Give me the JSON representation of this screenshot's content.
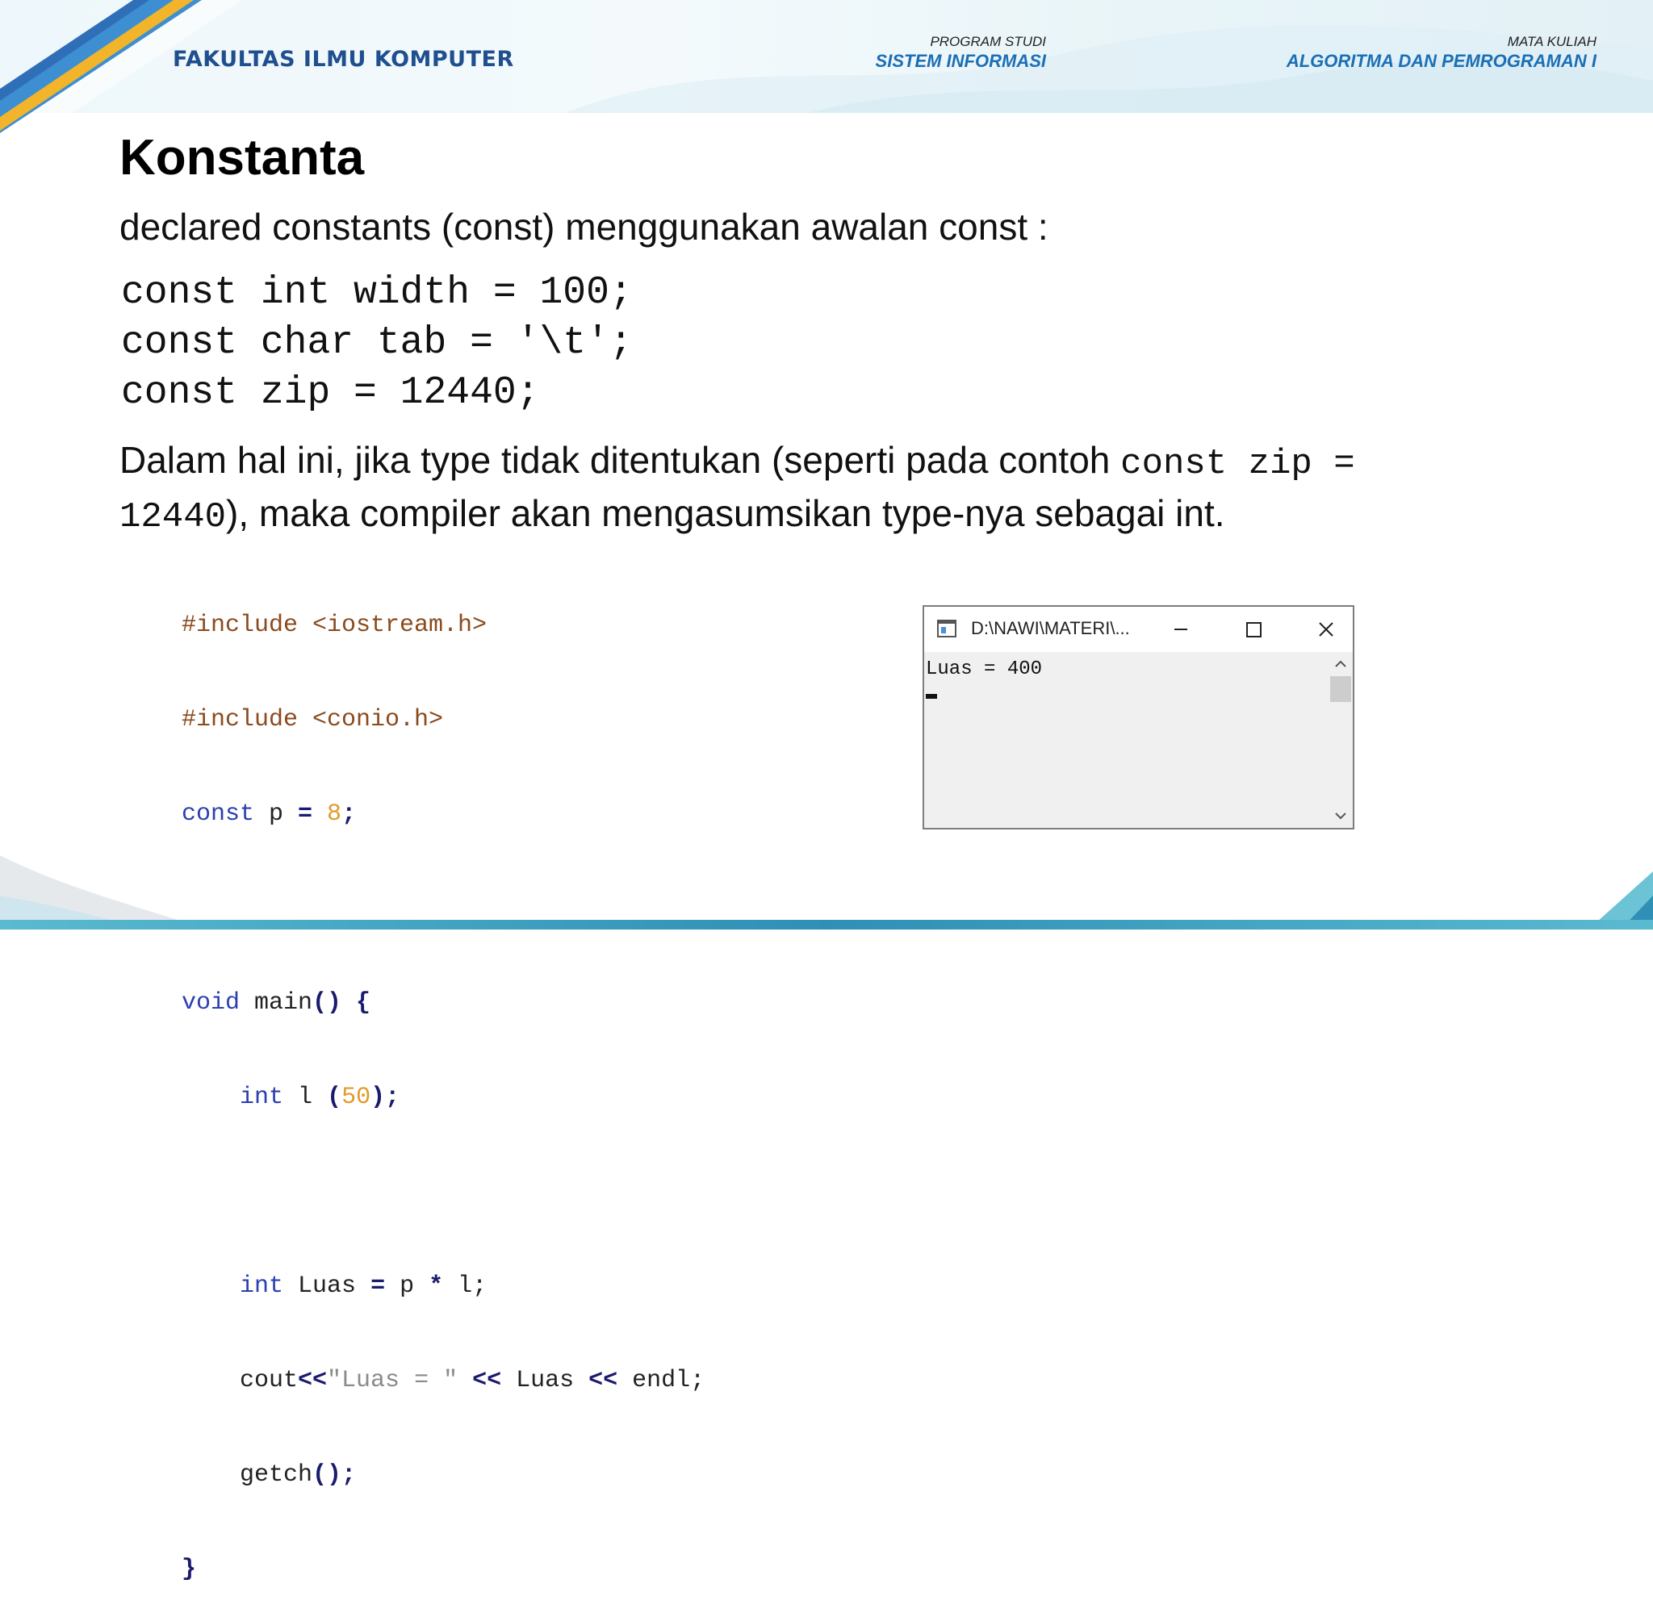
{
  "header": {
    "faculty": "FAKULTAS ILMU KOMPUTER",
    "program_caption": "PROGRAM STUDI",
    "program_value": "SISTEM INFORMASI",
    "course_caption": "MATA KULIAH",
    "course_value": "ALGORITMA DAN PEMROGRAMAN I"
  },
  "slide": {
    "title": "Konstanta",
    "intro": "declared constants (const) menggunakan awalan const  :",
    "code_lines": [
      "const int width = 100;",
      "const char tab = '\\t';",
      "const zip = 12440;"
    ],
    "explain_part1": "Dalam hal ini, jika type tidak ditentukan (seperti pada contoh ",
    "explain_mono1": "const zip = ",
    "explain_mono2": "12440",
    "explain_part2": "), maka compiler akan mengasumsikan type-nya sebagai int."
  },
  "source": {
    "include1": "#include <iostream.h>",
    "include2": "#include <conio.h>",
    "const_kw": "const",
    "const_rest": " p ",
    "const_eq": "=",
    "const_num": " 8",
    "const_semi": ";",
    "void_kw": "void",
    "main_name": " main",
    "main_parens": "()",
    "main_brace": " {",
    "int_kw": "int",
    "l_decl": " l ",
    "l_open": "(",
    "l_num": "50",
    "l_close": ");",
    "luas_decl": " Luas ",
    "luas_eq": "=",
    "luas_p": " p ",
    "luas_mul": "*",
    "luas_l": " l;",
    "cout_name": "cout",
    "cout_op1": "<<",
    "cout_str": "\"Luas = \"",
    "cout_op2": " <<",
    "cout_var": " Luas ",
    "cout_op3": "<<",
    "cout_endl": " endl;",
    "getch_name": "getch",
    "getch_parens": "();",
    "close_brace": "}"
  },
  "console": {
    "title": "D:\\NAWI\\MATERI\\...",
    "output": "Luas = 400"
  },
  "icons": {
    "minimize": "minimize-icon",
    "maximize": "maximize-icon",
    "close": "close-icon",
    "scroll_up": "chevron-up-icon",
    "scroll_down": "chevron-down-icon"
  },
  "colors": {
    "faculty_text": "#1f4f8f",
    "header_value_text": "#1b6fb5",
    "keyword": "#2a3fb0",
    "preprocessor": "#8b4a1c",
    "number": "#e39a28",
    "string": "#8a8a8a"
  }
}
